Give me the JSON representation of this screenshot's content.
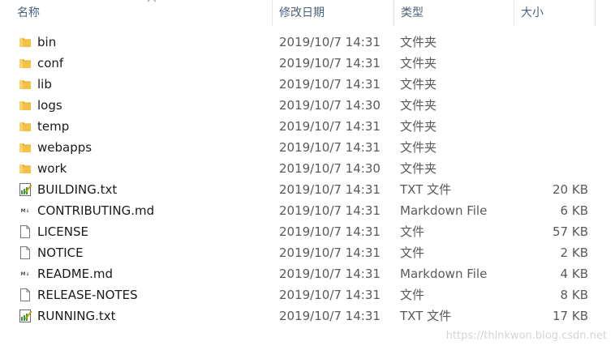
{
  "header": {
    "name": "名称",
    "date": "修改日期",
    "type": "类型",
    "size": "大小",
    "sort_indicator": "^"
  },
  "files": [
    {
      "icon": "folder-icon",
      "name": "bin",
      "date": "2019/10/7 14:31",
      "type": "文件夹",
      "size": ""
    },
    {
      "icon": "folder-icon",
      "name": "conf",
      "date": "2019/10/7 14:31",
      "type": "文件夹",
      "size": ""
    },
    {
      "icon": "folder-icon",
      "name": "lib",
      "date": "2019/10/7 14:31",
      "type": "文件夹",
      "size": ""
    },
    {
      "icon": "folder-icon",
      "name": "logs",
      "date": "2019/10/7 14:30",
      "type": "文件夹",
      "size": ""
    },
    {
      "icon": "folder-icon",
      "name": "temp",
      "date": "2019/10/7 14:31",
      "type": "文件夹",
      "size": ""
    },
    {
      "icon": "folder-icon",
      "name": "webapps",
      "date": "2019/10/7 14:31",
      "type": "文件夹",
      "size": ""
    },
    {
      "icon": "folder-icon",
      "name": "work",
      "date": "2019/10/7 14:30",
      "type": "文件夹",
      "size": ""
    },
    {
      "icon": "text-file-icon",
      "name": "BUILDING.txt",
      "date": "2019/10/7 14:31",
      "type": "TXT 文件",
      "size": "20 KB"
    },
    {
      "icon": "markdown-file-icon",
      "name": "CONTRIBUTING.md",
      "date": "2019/10/7 14:31",
      "type": "Markdown File",
      "size": "6 KB"
    },
    {
      "icon": "blank-file-icon",
      "name": "LICENSE",
      "date": "2019/10/7 14:31",
      "type": "文件",
      "size": "57 KB"
    },
    {
      "icon": "blank-file-icon",
      "name": "NOTICE",
      "date": "2019/10/7 14:31",
      "type": "文件",
      "size": "2 KB"
    },
    {
      "icon": "markdown-file-icon",
      "name": "README.md",
      "date": "2019/10/7 14:31",
      "type": "Markdown File",
      "size": "4 KB"
    },
    {
      "icon": "blank-file-icon",
      "name": "RELEASE-NOTES",
      "date": "2019/10/7 14:31",
      "type": "文件",
      "size": "8 KB"
    },
    {
      "icon": "text-file-icon",
      "name": "RUNNING.txt",
      "date": "2019/10/7 14:31",
      "type": "TXT 文件",
      "size": "17 KB"
    }
  ],
  "watermark": "https://thinkwon.blog.csdn.net",
  "colors": {
    "folder": "#f4c145",
    "folder_dark": "#e0a82e",
    "header_text": "#4c607a",
    "secondary_text": "#5a5a5a"
  }
}
